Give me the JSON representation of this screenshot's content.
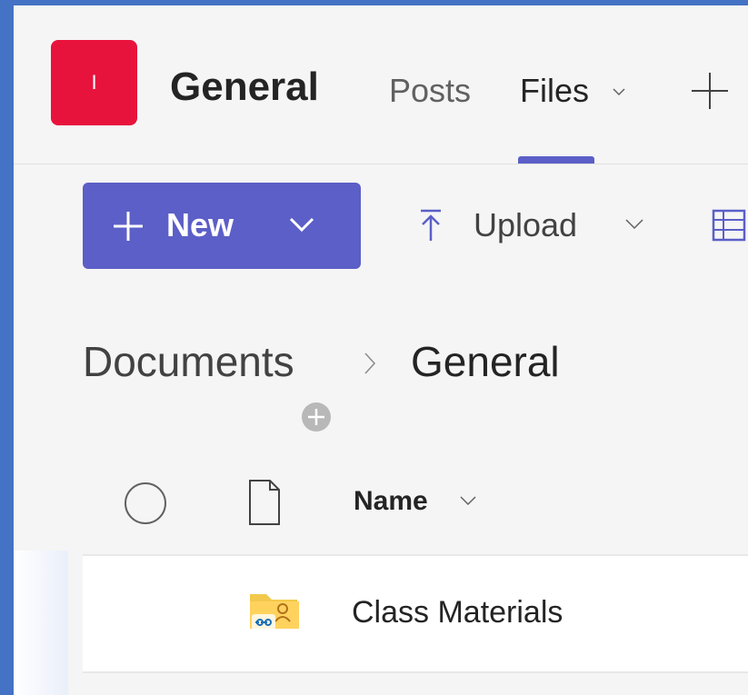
{
  "header": {
    "team_avatar_text": "I",
    "channel_title": "General",
    "tabs": [
      {
        "label": "Posts",
        "active": false
      },
      {
        "label": "Files",
        "active": true
      }
    ],
    "add_tab_icon": "plus-icon"
  },
  "toolbar": {
    "new_label": "New",
    "upload_label": "Upload",
    "accent_color": "#5b5fc7"
  },
  "breadcrumb": {
    "root": "Documents",
    "current": "General"
  },
  "file_list": {
    "columns": [
      "Name"
    ],
    "rows": [
      {
        "name": "Class Materials",
        "icon": "shared-folder-icon"
      }
    ]
  },
  "colors": {
    "team_avatar": "#e8133d",
    "frame_border": "#4472c4"
  }
}
